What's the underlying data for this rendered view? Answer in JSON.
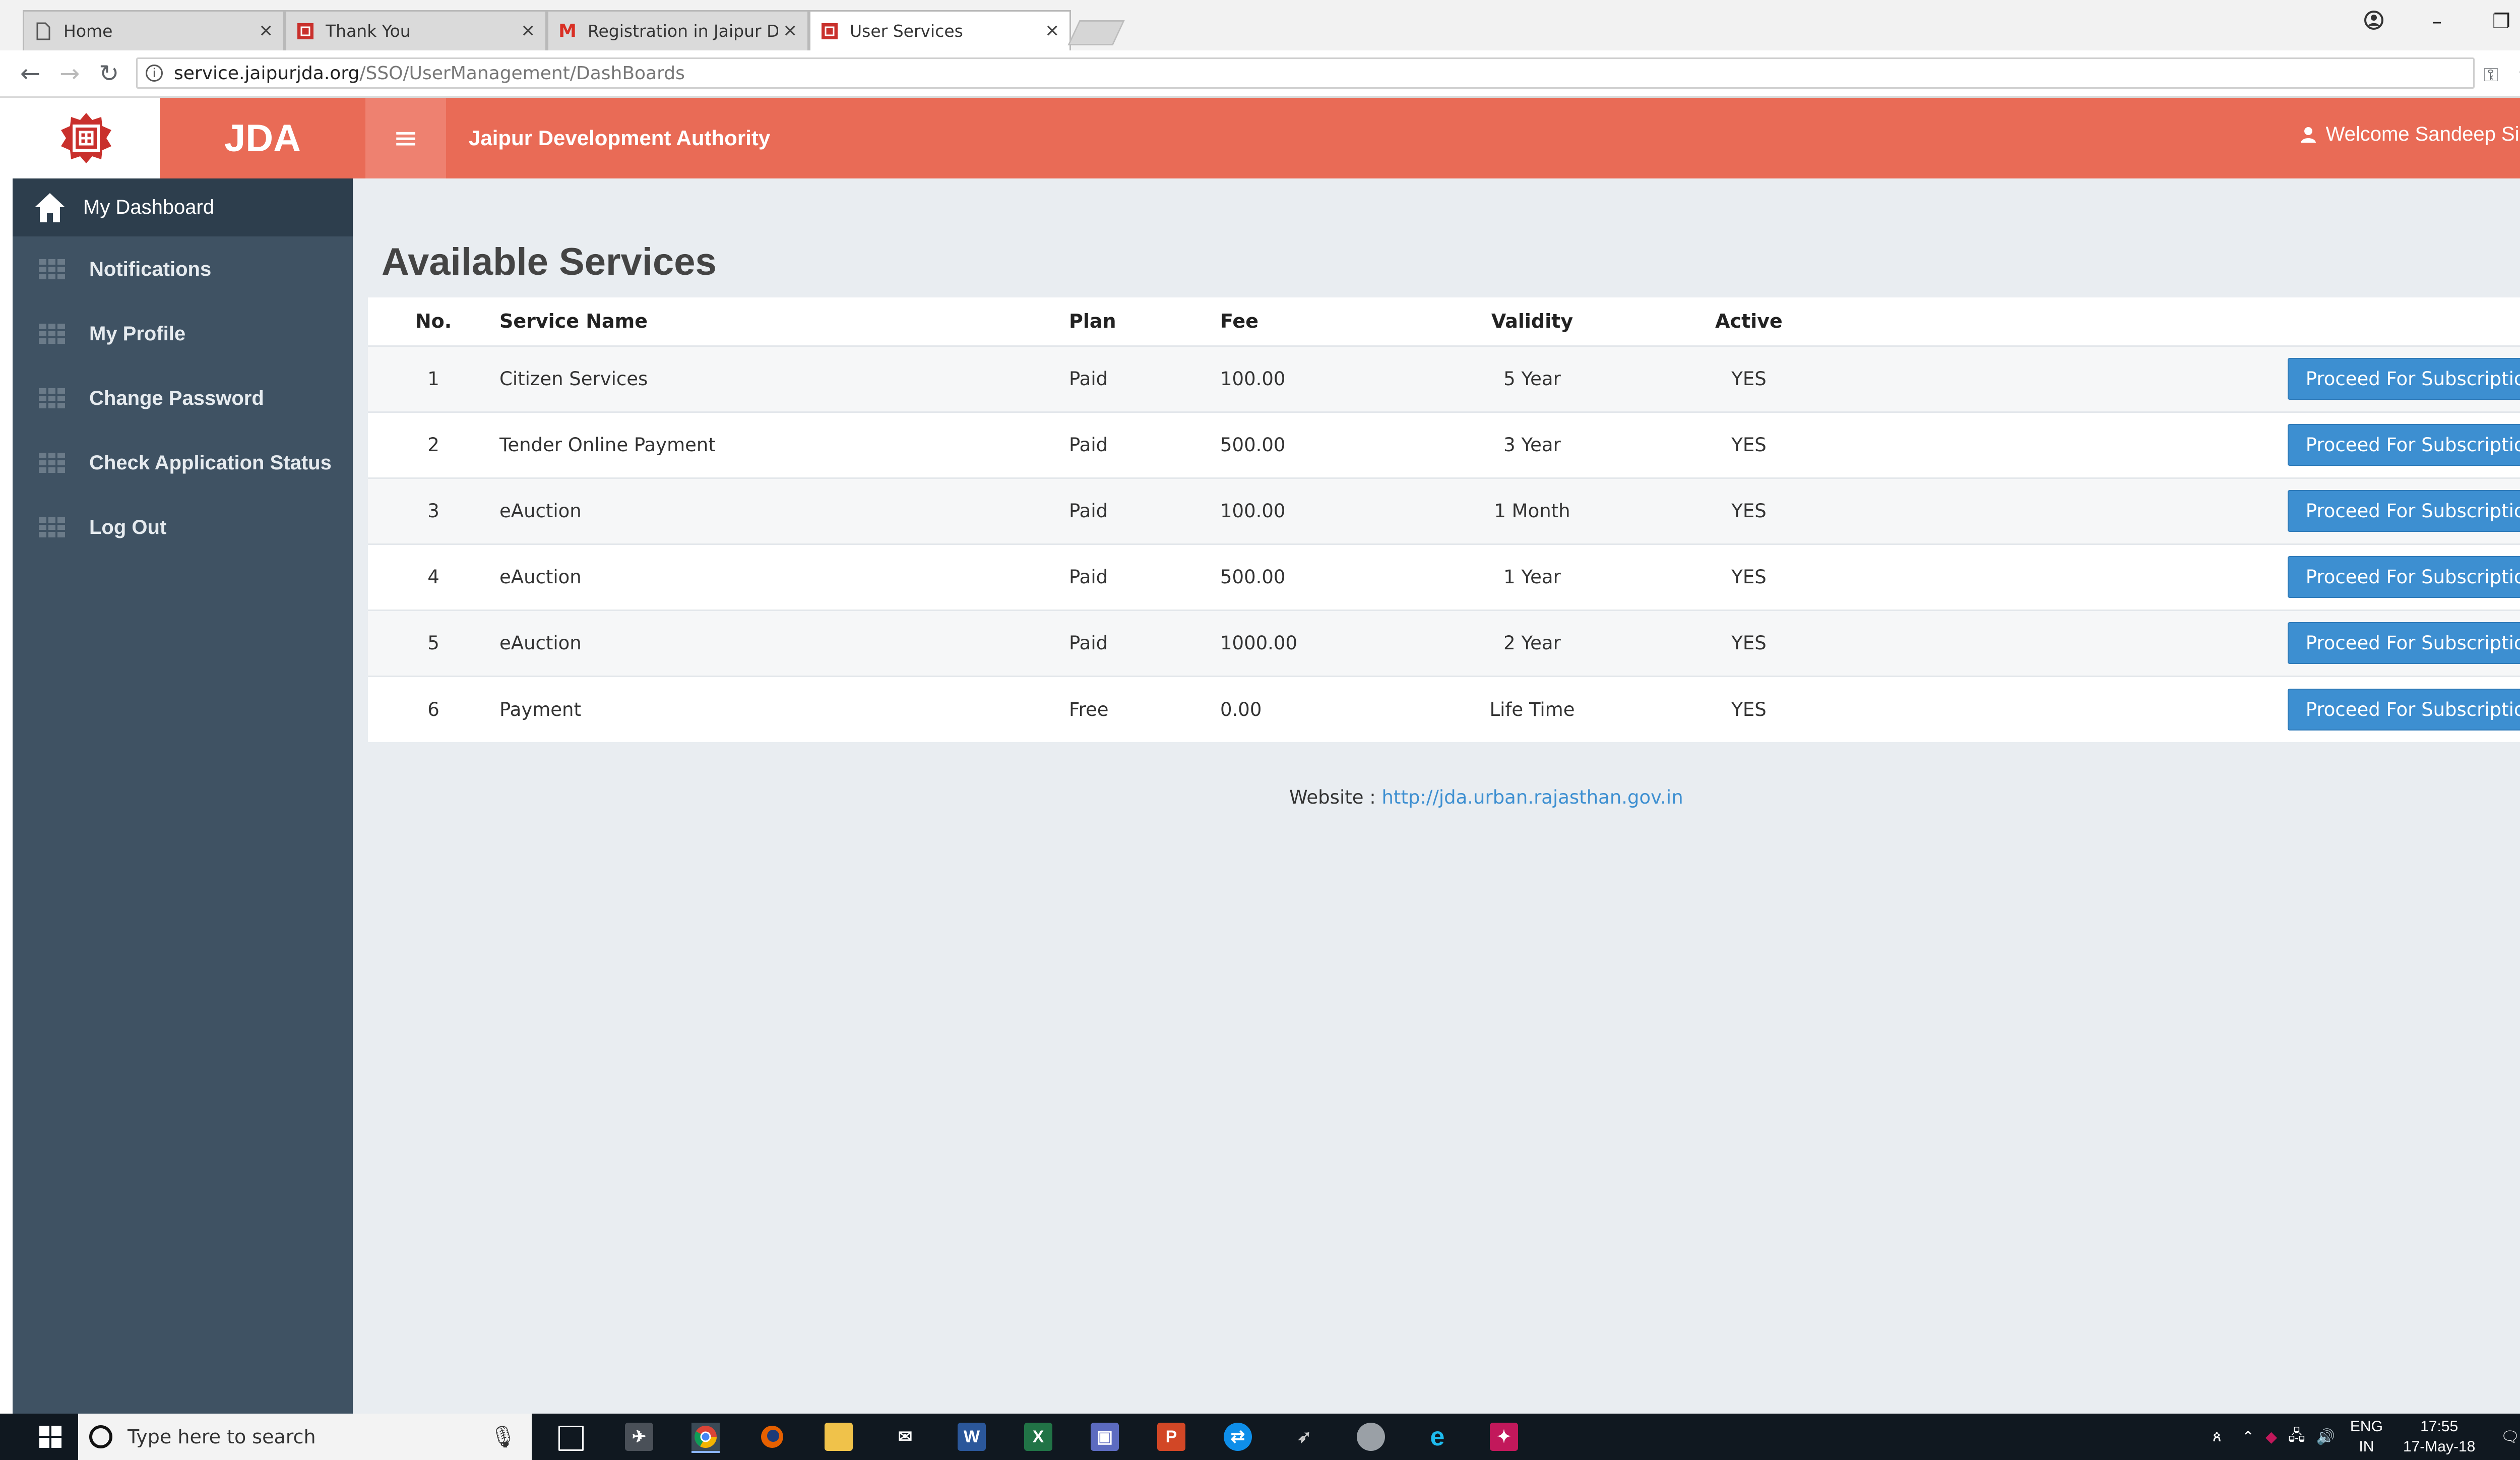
{
  "browser": {
    "tabs": [
      {
        "title": "Home",
        "icon": "page-icon"
      },
      {
        "title": "Thank You",
        "icon": "jda-favicon"
      },
      {
        "title": "Registration in Jaipur De",
        "icon": "gmail-icon"
      },
      {
        "title": "User Services",
        "icon": "jda-favicon",
        "active": true
      }
    ],
    "url_host": "service.jaipurjda.org",
    "url_path": "/SSO/UserManagement/DashBoards"
  },
  "header": {
    "brand": "JDA",
    "org_title": "Jaipur Development Authority",
    "welcome": "Welcome Sandeep Singh",
    "accent_color": "#e96b56"
  },
  "sidebar": {
    "items": [
      {
        "label": "My Dashboard",
        "icon": "home-icon",
        "active": true
      },
      {
        "label": "Notifications",
        "icon": "grid-icon"
      },
      {
        "label": "My Profile",
        "icon": "grid-icon"
      },
      {
        "label": "Change Password",
        "icon": "grid-icon"
      },
      {
        "label": "Check Application Status",
        "icon": "grid-icon"
      },
      {
        "label": "Log Out",
        "icon": "grid-icon"
      }
    ]
  },
  "main": {
    "title": "Available Services",
    "columns": [
      "No.",
      "Service Name",
      "Plan",
      "Fee",
      "Validity",
      "Active"
    ],
    "rows": [
      {
        "no": "1",
        "name": "Citizen Services",
        "plan": "Paid",
        "fee": "100.00",
        "validity": "5 Year",
        "active": "YES",
        "action": "Proceed For Subscription"
      },
      {
        "no": "2",
        "name": "Tender Online Payment",
        "plan": "Paid",
        "fee": "500.00",
        "validity": "3 Year",
        "active": "YES",
        "action": "Proceed For Subscription"
      },
      {
        "no": "3",
        "name": "eAuction",
        "plan": "Paid",
        "fee": "100.00",
        "validity": "1 Month",
        "active": "YES",
        "action": "Proceed For Subscription"
      },
      {
        "no": "4",
        "name": "eAuction",
        "plan": "Paid",
        "fee": "500.00",
        "validity": "1 Year",
        "active": "YES",
        "action": "Proceed For Subscription"
      },
      {
        "no": "5",
        "name": "eAuction",
        "plan": "Paid",
        "fee": "1000.00",
        "validity": "2 Year",
        "active": "YES",
        "action": "Proceed For Subscription"
      },
      {
        "no": "6",
        "name": "Payment",
        "plan": "Free",
        "fee": "0.00",
        "validity": "Life Time",
        "active": "YES",
        "action": "Proceed For Subscription"
      }
    ],
    "button_color": "#3d8fd1",
    "footer_label": "Website : ",
    "footer_link": "http://jda.urban.rajasthan.gov.in"
  },
  "taskbar": {
    "search_placeholder": "Type here to search",
    "lang": "ENG",
    "region": "IN",
    "time": "17:55",
    "date": "17-May-18"
  }
}
